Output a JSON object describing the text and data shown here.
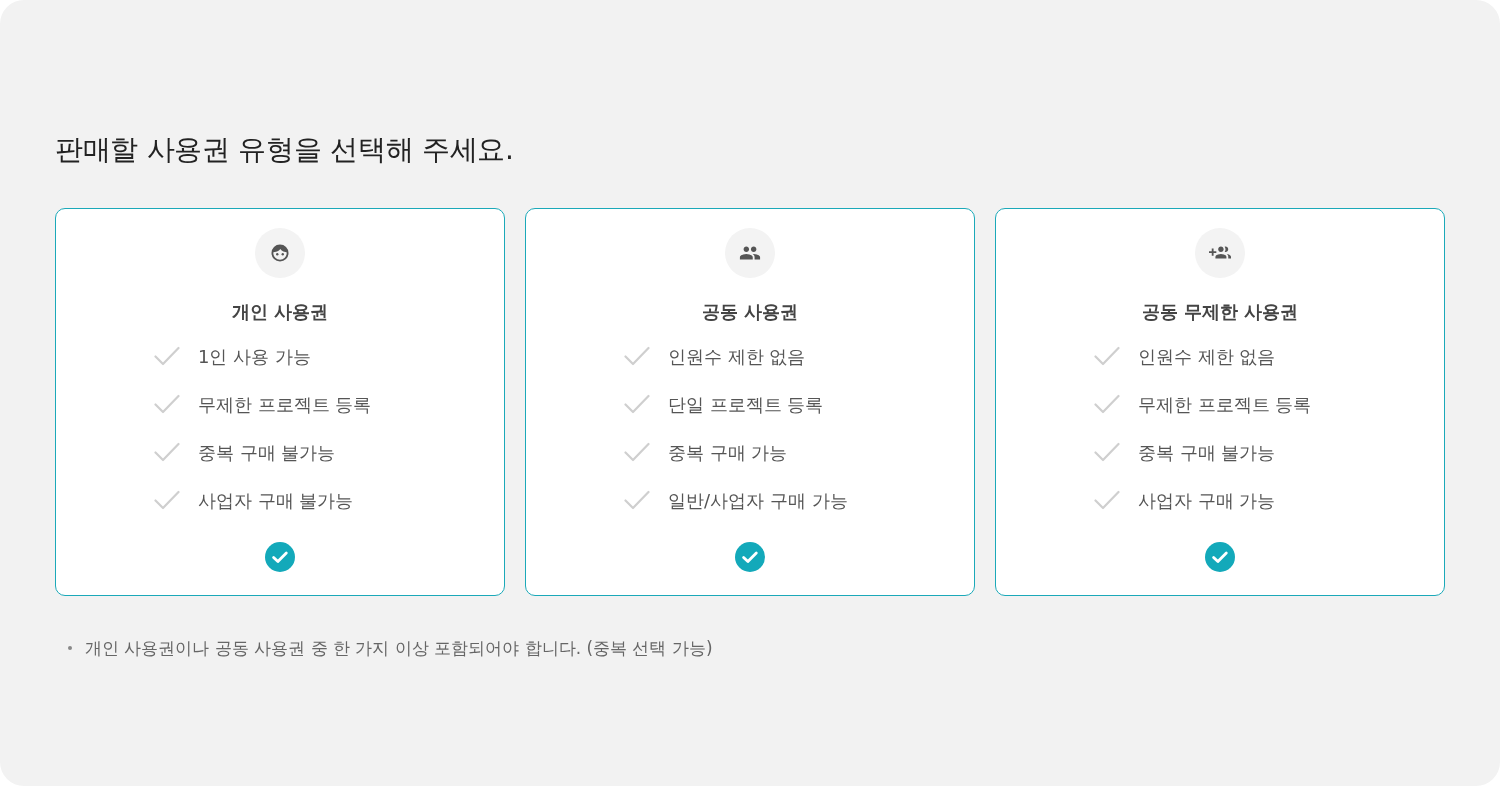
{
  "heading": "판매할 사용권 유형을 선택해 주세요.",
  "plans": [
    {
      "kind": "face",
      "title": "개인 사용권",
      "selected": true,
      "features": [
        "1인 사용 가능",
        "무제한 프로젝트 등록",
        "중복 구매 불가능",
        "사업자 구매 불가능"
      ]
    },
    {
      "kind": "group",
      "title": "공동 사용권",
      "selected": true,
      "features": [
        "인원수 제한 없음",
        "단일 프로젝트 등록",
        "중복 구매 가능",
        "일반/사업자 구매 가능"
      ]
    },
    {
      "kind": "group_add",
      "title": "공동 무제한 사용권",
      "selected": true,
      "features": [
        "인원수 제한 없음",
        "무제한 프로젝트 등록",
        "중복 구매 불가능",
        "사업자 구매 가능"
      ]
    }
  ],
  "notes": [
    "개인 사용권이나 공동 사용권 중 한 가지 이상 포함되어야 합니다. (중복 선택 가능)"
  ]
}
